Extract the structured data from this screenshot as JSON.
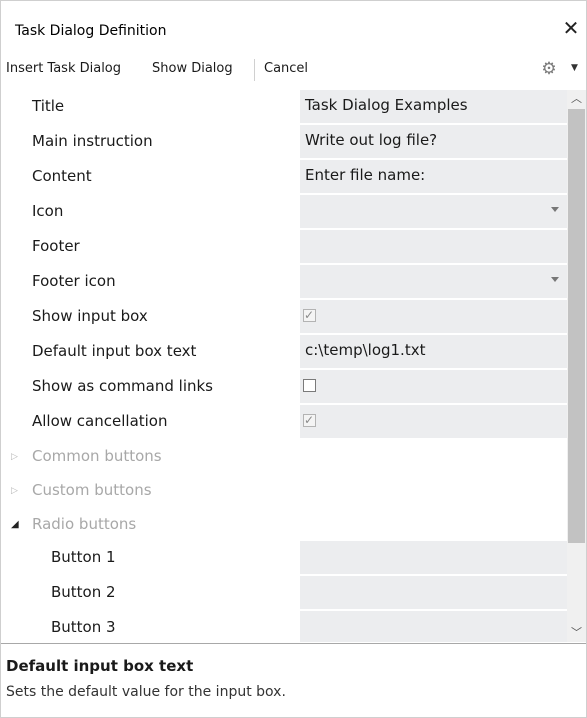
{
  "window": {
    "title": "Task Dialog Definition",
    "close_glyph": "✕"
  },
  "toolbar": {
    "insert_label": "Insert Task Dialog",
    "show_label": "Show Dialog",
    "cancel_label": "Cancel",
    "settings_icon": "gear-icon",
    "overflow_icon": "chevron-down-icon"
  },
  "properties": [
    {
      "name": "Title",
      "value": "Task Dialog Examples",
      "type": "text"
    },
    {
      "name": "Main instruction",
      "value": "Write out log file?",
      "type": "text"
    },
    {
      "name": "Content",
      "value": "Enter file name:",
      "type": "text"
    },
    {
      "name": "Icon",
      "value": "",
      "type": "dropdown"
    },
    {
      "name": "Footer",
      "value": "",
      "type": "text"
    },
    {
      "name": "Footer icon",
      "value": "",
      "type": "dropdown"
    },
    {
      "name": "Show input box",
      "checked": true,
      "type": "checkbox"
    },
    {
      "name": "Default input box text",
      "value": "c:\\temp\\log1.txt",
      "type": "text"
    },
    {
      "name": "Show as command links",
      "checked": false,
      "type": "checkbox"
    },
    {
      "name": "Allow cancellation",
      "checked": true,
      "type": "checkbox"
    }
  ],
  "categories": [
    {
      "name": "Common buttons",
      "expanded": false
    },
    {
      "name": "Custom buttons",
      "expanded": false
    },
    {
      "name": "Radio buttons",
      "expanded": true
    }
  ],
  "radio_buttons": [
    {
      "name": "Button 1",
      "value": ""
    },
    {
      "name": "Button 2",
      "value": ""
    },
    {
      "name": "Button 3",
      "value": ""
    }
  ],
  "help": {
    "title": "Default input box text",
    "text": "Sets the default value for the input box."
  },
  "colors": {
    "value_cell_bg": "#ecedef",
    "category_text": "#a8a8a8",
    "scroll_thumb": "#c2c2c2"
  }
}
